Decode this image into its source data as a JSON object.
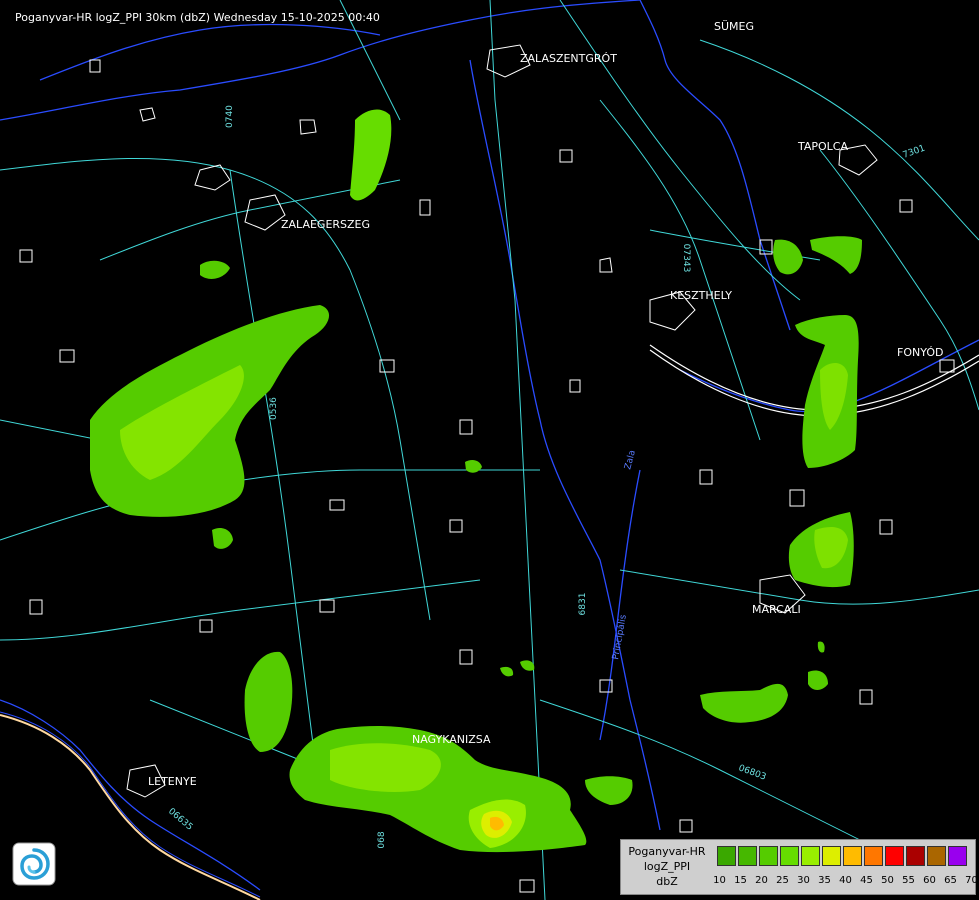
{
  "title": "Poganyvar-HR logZ_PPI 30km (dbZ) Wednesday 15-10-2025 00:40",
  "cities": [
    {
      "name": "SÜMEG"
    },
    {
      "name": "ZALASZENTGRÓT"
    },
    {
      "name": "TAPOLCA"
    },
    {
      "name": "ZALAEGERSZEG"
    },
    {
      "name": "KESZTHELY"
    },
    {
      "name": "FONYÓD"
    },
    {
      "name": "MARCALI"
    },
    {
      "name": "NAGYKANIZSA"
    },
    {
      "name": "LETENYE"
    }
  ],
  "road_labels": [
    "0740",
    "07343",
    "7301",
    "0536",
    "6831",
    "06635",
    "06803",
    "068"
  ],
  "river_labels": [
    "Zala",
    "Principális"
  ],
  "legend": {
    "name_line1": "Poganyvar-HR",
    "name_line2": "logZ_PPI",
    "name_line3": "dbZ",
    "levels": [
      {
        "value": "10",
        "color": "#3aa800"
      },
      {
        "value": "15",
        "color": "#46b800"
      },
      {
        "value": "20",
        "color": "#55cc00"
      },
      {
        "value": "25",
        "color": "#66dd00"
      },
      {
        "value": "30",
        "color": "#99ee00"
      },
      {
        "value": "35",
        "color": "#ddee00"
      },
      {
        "value": "40",
        "color": "#ffbb00"
      },
      {
        "value": "45",
        "color": "#ff7700"
      },
      {
        "value": "50",
        "color": "#ff0000"
      },
      {
        "value": "55",
        "color": "#aa0000"
      },
      {
        "value": "60",
        "color": "#aa6600"
      },
      {
        "value": "65",
        "color": "#9900ee"
      },
      {
        "value": "70",
        "color": "#aaaaff"
      }
    ]
  },
  "colors": {
    "background": "#000000",
    "roads": "#40d8d8",
    "rivers": "#2a4cff",
    "borders": "#ffffff",
    "country_border": "#ffd8a0"
  }
}
